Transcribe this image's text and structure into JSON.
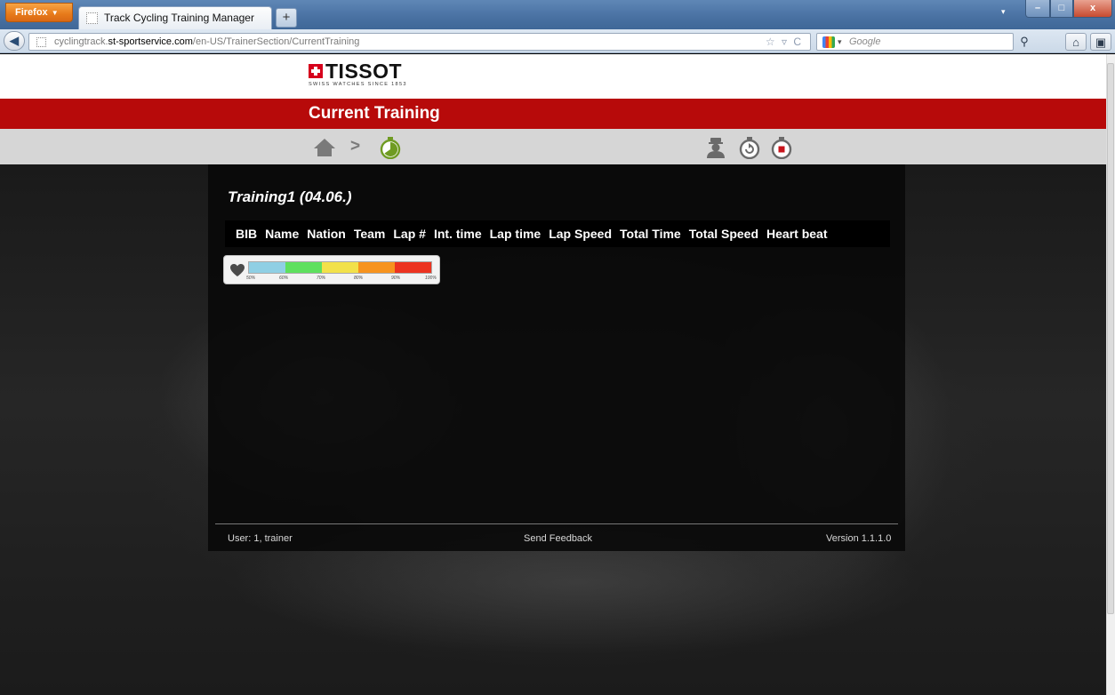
{
  "browser": {
    "menu_button": "Firefox",
    "tab_title": "Track Cycling Training Manager",
    "new_tab": "+",
    "tabs_menu": "▾",
    "url": {
      "prefix": "cyclingtrack.",
      "host": "st-sportservice.com",
      "path": "/en-US/TrainerSection/CurrentTraining"
    },
    "url_icons": "☆ ▿ C",
    "search_placeholder": "Google",
    "window_controls": {
      "minimize": "–",
      "maximize": "□",
      "close": "x"
    }
  },
  "brand": {
    "name": "TISSOT",
    "tagline": "SWISS WATCHES SINCE 1853",
    "color": "#d6001c"
  },
  "header": {
    "title": "Current Training",
    "accent": "#b70a0a"
  },
  "breadcrumb": {
    "separator": ">"
  },
  "icons": {
    "breadcrumb": [
      "home-icon",
      "stopwatch-icon"
    ],
    "actions": [
      "trainer-icon",
      "restart-stopwatch-icon",
      "stop-stopwatch-icon"
    ]
  },
  "training": {
    "title": "Training1 (04.06.)",
    "columns": [
      "BIB",
      "Name",
      "Nation",
      "Team",
      "Lap #",
      "Int. time",
      "Lap time",
      "Lap Speed",
      "Total Time",
      "Total Speed",
      "Heart beat"
    ]
  },
  "heart_rate_legend": {
    "labels": [
      "50%",
      "60%",
      "70%",
      "80%",
      "90%",
      "100%"
    ],
    "colors": [
      "#8fcfe4",
      "#5ee05e",
      "#f2e14a",
      "#f7931e",
      "#ec3320"
    ]
  },
  "footer": {
    "user": "User: 1, trainer",
    "feedback": "Send Feedback",
    "version": "Version 1.1.1.0"
  }
}
